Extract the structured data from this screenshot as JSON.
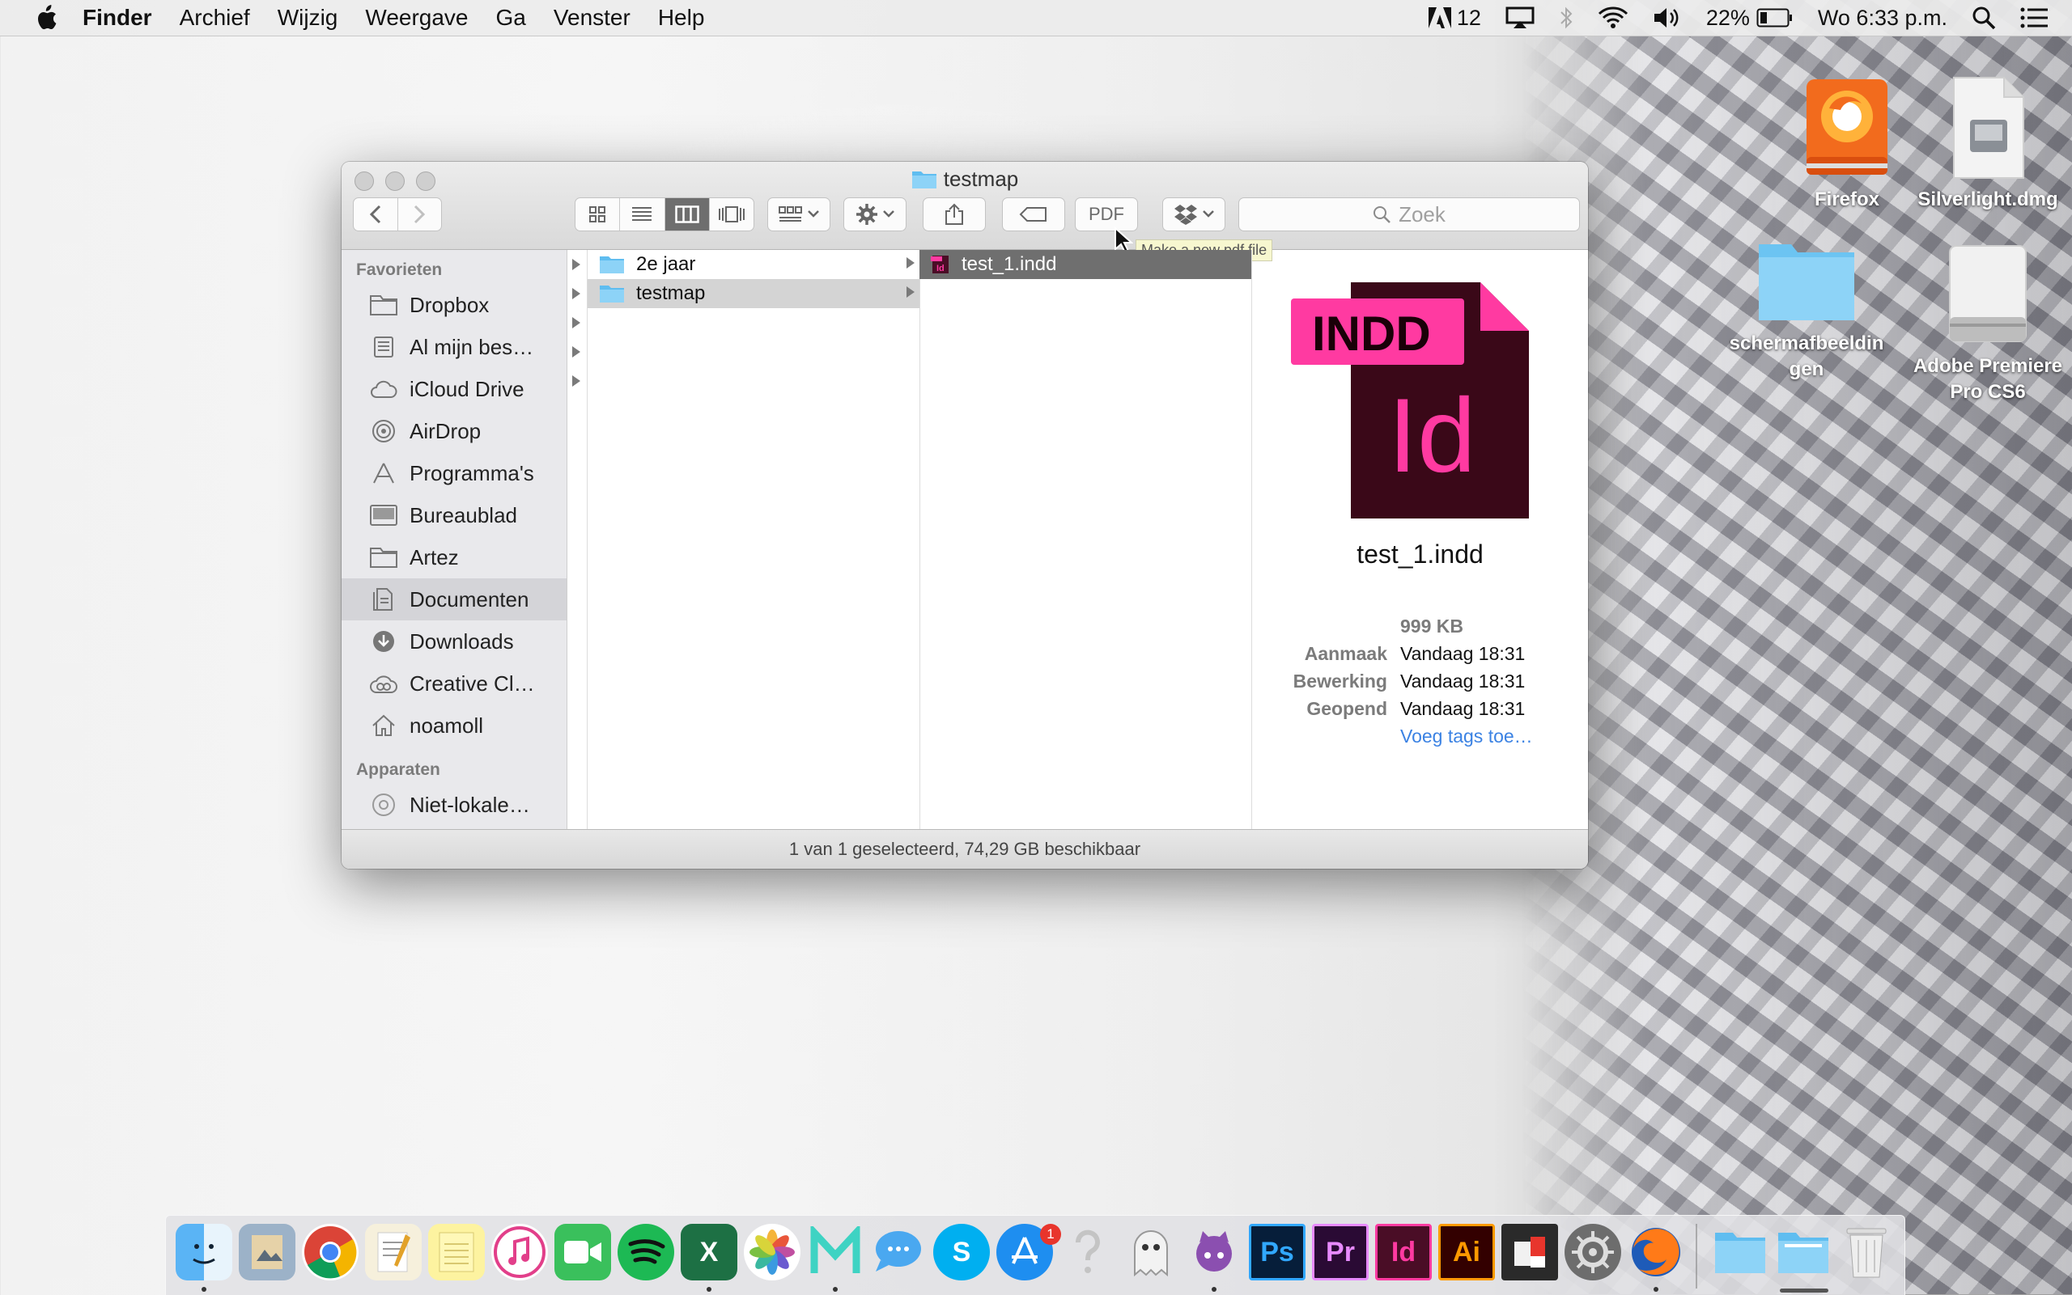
{
  "menubar": {
    "app": "Finder",
    "items": [
      "Archief",
      "Wijzig",
      "Weergave",
      "Ga",
      "Venster",
      "Help"
    ],
    "adobe_count": "12",
    "battery": "22%",
    "clock": "Wo 6:33 p.m."
  },
  "desktop": {
    "icons": [
      "Firefox",
      "Silverlight.dmg",
      "schermafbeeldin gen",
      "Adobe Premiere Pro CS6"
    ]
  },
  "window": {
    "title": "testmap",
    "search_placeholder": "Zoek",
    "pdf_label": "PDF",
    "tooltip": "Make a new pdf file",
    "sidebar": {
      "favorites_header": "Favorieten",
      "items": [
        "Dropbox",
        "Al mijn bes…",
        "iCloud Drive",
        "AirDrop",
        "Programma's",
        "Bureaublad",
        "Artez",
        "Documenten",
        "Downloads",
        "Creative Cl…",
        "noamoll"
      ],
      "selected": "Documenten",
      "devices_header": "Apparaten",
      "devices": [
        "Niet-lokale…"
      ]
    },
    "column2": [
      "2e jaar",
      "testmap"
    ],
    "column3": [
      "test_1.indd"
    ],
    "preview": {
      "badge": "INDD",
      "glyph": "Id",
      "filename": "test_1.indd",
      "size": "999 KB",
      "created_label": "Aanmaak",
      "created": "Vandaag 18:31",
      "modified_label": "Bewerking",
      "modified": "Vandaag 18:31",
      "opened_label": "Geopend",
      "opened": "Vandaag 18:31",
      "add_tags": "Voeg tags toe…"
    },
    "status": "1 van 1 geselecteerd, 74,29 GB beschikbaar"
  },
  "dock": {
    "badge_count": "1",
    "labels": {
      "ps": "Ps",
      "pr": "Pr",
      "id": "Id",
      "ai": "Ai"
    }
  }
}
